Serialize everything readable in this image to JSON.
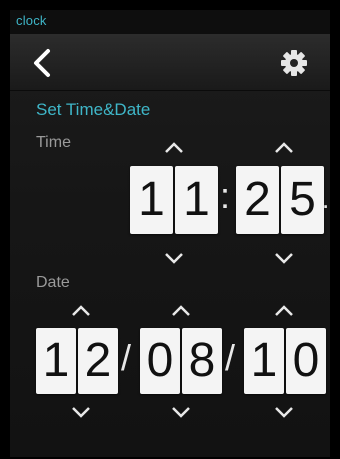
{
  "app": {
    "name": "clock"
  },
  "toolbar": {
    "back_icon": "chevron-left-icon",
    "settings_icon": "gear-icon"
  },
  "section": {
    "title": "Set Time&Date"
  },
  "time": {
    "label": "Time",
    "hours": [
      "1",
      "1"
    ],
    "separator": ":",
    "minutes": [
      "2",
      "5"
    ],
    "trailing": "."
  },
  "date": {
    "label": "Date",
    "part1": [
      "1",
      "2"
    ],
    "sep1": "/",
    "part2": [
      "0",
      "8"
    ],
    "sep2": "/",
    "part3": [
      "1",
      "0"
    ]
  },
  "colors": {
    "accent": "#3fb6c8",
    "label": "#9a9a9a",
    "digit_bg": "#f4f4f4"
  }
}
